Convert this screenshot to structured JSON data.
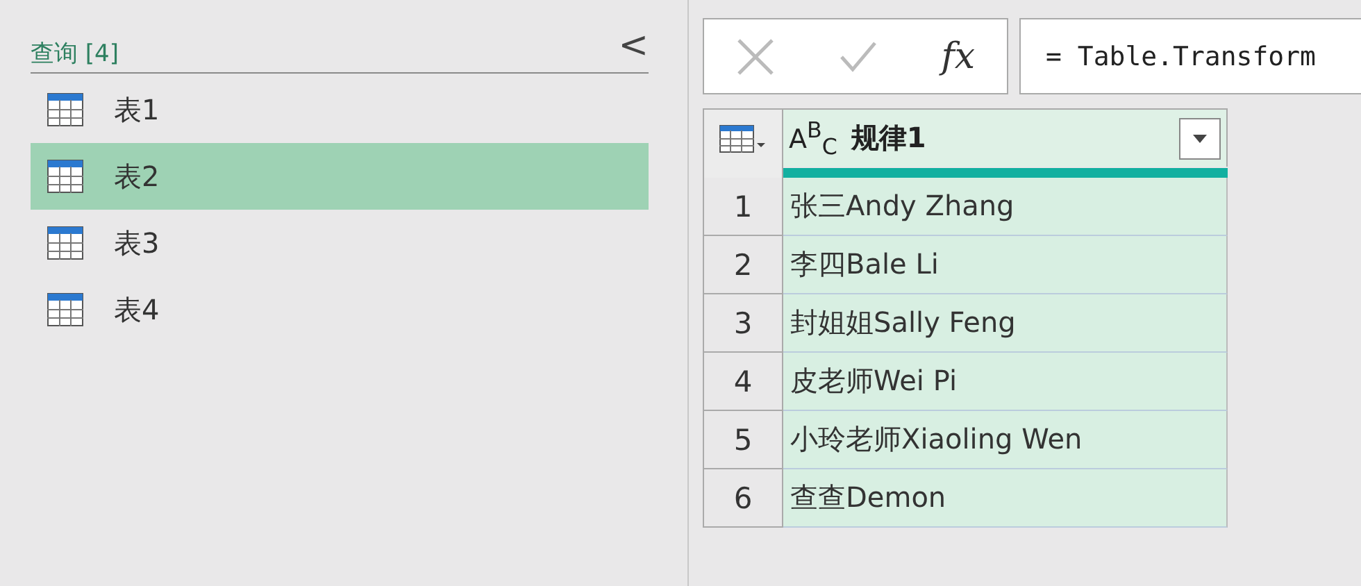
{
  "queries_pane": {
    "title": "查询 [4]",
    "collapse": "<",
    "items": [
      {
        "label": "表1",
        "selected": false
      },
      {
        "label": "表2",
        "selected": true
      },
      {
        "label": "表3",
        "selected": false
      },
      {
        "label": "表4",
        "selected": false
      }
    ]
  },
  "formula_bar": {
    "fx": "fx",
    "formula": "= Table.Transform"
  },
  "table": {
    "column": {
      "type": "A$^{B}$$_{C}$",
      "name": "规律1"
    },
    "rows": [
      {
        "index": "1",
        "value": "张三Andy Zhang"
      },
      {
        "index": "2",
        "value": "李四Bale Li"
      },
      {
        "index": "3",
        "value": "封姐姐Sally Feng"
      },
      {
        "index": "4",
        "value": "皮老师Wei Pi"
      },
      {
        "index": "5",
        "value": "小玲老师Xiaoling Wen"
      },
      {
        "index": "6",
        "value": "查查Demon"
      }
    ]
  }
}
